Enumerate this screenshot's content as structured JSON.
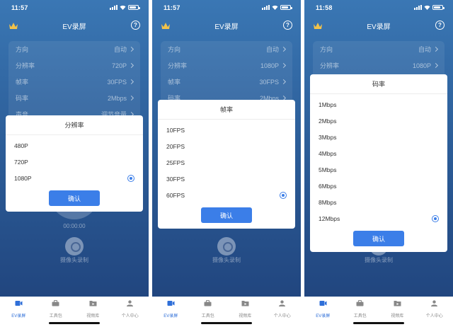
{
  "phones": [
    {
      "time": "11:57",
      "header_title": "EV录屏",
      "settings": [
        {
          "label": "方向",
          "value": "自动"
        },
        {
          "label": "分辨率",
          "value": "720P"
        },
        {
          "label": "帧率",
          "value": "30FPS"
        },
        {
          "label": "码率",
          "value": "2Mbps"
        },
        {
          "label": "声音",
          "value": "调节音量"
        }
      ],
      "timer": "00:00:00",
      "camera_label": "摄像头录制",
      "modal": {
        "title": "分辨率",
        "options": [
          "480P",
          "720P",
          "1080P"
        ],
        "selected_index": 2,
        "confirm_label": "确认"
      }
    },
    {
      "time": "11:57",
      "header_title": "EV录屏",
      "settings": [
        {
          "label": "方向",
          "value": "自动"
        },
        {
          "label": "分辨率",
          "value": "1080P"
        },
        {
          "label": "帧率",
          "value": "30FPS"
        },
        {
          "label": "码率",
          "value": "2Mbps"
        }
      ],
      "camera_label": "摄像头录制",
      "modal": {
        "title": "帧率",
        "options": [
          "10FPS",
          "20FPS",
          "25FPS",
          "30FPS",
          "60FPS"
        ],
        "selected_index": 4,
        "confirm_label": "确认"
      }
    },
    {
      "time": "11:58",
      "header_title": "EV录屏",
      "settings": [
        {
          "label": "方向",
          "value": "自动"
        },
        {
          "label": "分辨率",
          "value": "1080P"
        }
      ],
      "camera_label": "摄像头录制",
      "modal": {
        "title": "码率",
        "options": [
          "1Mbps",
          "2Mbps",
          "3Mbps",
          "4Mbps",
          "5Mbps",
          "6Mbps",
          "8Mbps",
          "12Mbps"
        ],
        "selected_index": 7,
        "confirm_label": "确认"
      }
    }
  ],
  "tabs": [
    "EV录屏",
    "工具包",
    "视频库",
    "个人中心"
  ],
  "active_tab_index": 0,
  "colors": {
    "accent": "#3b7ee8",
    "background_top": "#3a77b4",
    "background_bottom": "#1f417a"
  }
}
